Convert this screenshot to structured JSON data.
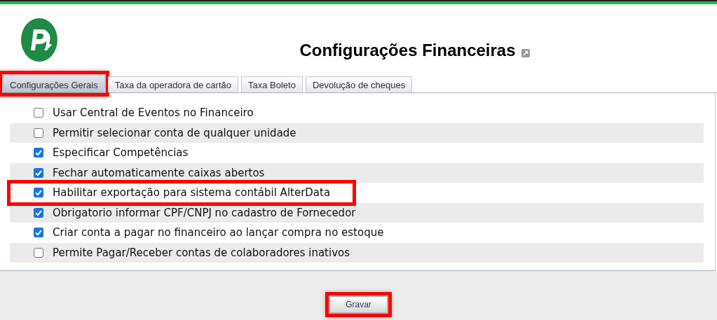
{
  "header": {
    "title": "Configurações Financeiras"
  },
  "tabs": [
    {
      "label": "Configurações Gerais",
      "selected": true,
      "highlighted": true
    },
    {
      "label": "Taxa da operadora de cartão",
      "selected": false,
      "highlighted": false
    },
    {
      "label": "Taxa Boleto",
      "selected": false,
      "highlighted": false
    },
    {
      "label": "Devolução de cheques",
      "selected": false,
      "highlighted": false
    }
  ],
  "options": [
    {
      "label": "Usar Central de Eventos no Financeiro",
      "checked": false,
      "highlighted": false
    },
    {
      "label": "Permitir selecionar conta de qualquer unidade",
      "checked": false,
      "highlighted": false
    },
    {
      "label": "Especificar Competências",
      "checked": true,
      "highlighted": false
    },
    {
      "label": "Fechar automaticamente caixas abertos",
      "checked": true,
      "highlighted": false
    },
    {
      "label": "Habilitar exportação para sistema contábil AlterData",
      "checked": true,
      "highlighted": true
    },
    {
      "label": "Obrigatorio informar CPF/CNPJ no cadastro de Fornecedor",
      "checked": true,
      "highlighted": false
    },
    {
      "label": "Criar conta a pagar no financeiro ao lançar compra no estoque",
      "checked": true,
      "highlighted": false
    },
    {
      "label": "Permite Pagar/Receber contas de colaboradores inativos",
      "checked": false,
      "highlighted": false
    }
  ],
  "save_button": {
    "label": "Gravar",
    "highlighted": true
  }
}
